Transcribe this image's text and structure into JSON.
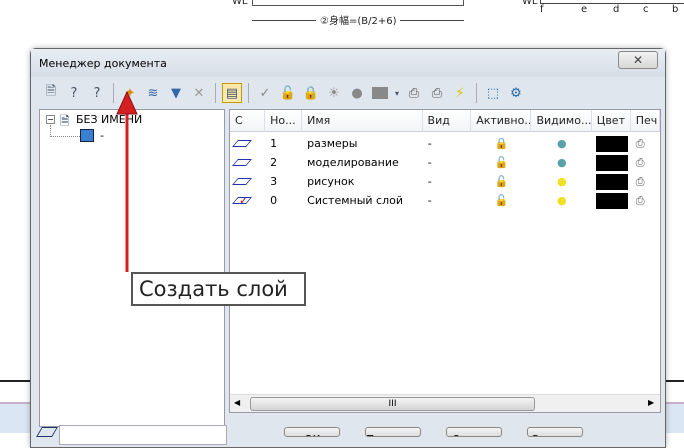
{
  "background": {
    "wl_left": "WL",
    "formula": "②身幅=(B/2+6)",
    "wl_right": "WL",
    "scale_letters": [
      "f",
      "e",
      "d",
      "c",
      "b"
    ]
  },
  "dialog": {
    "title": "Менеджер документа",
    "close_glyph": "✕",
    "toolbar": [
      "new-doc-icon",
      "layer-numbers-icon",
      "help-layers-icon",
      "create-layer-icon",
      "layer-stack-icon",
      "layer-filter-icon",
      "delete-icon",
      "panel-view-icon",
      "check-icon",
      "unlock-icon",
      "lock-icon",
      "light-on-icon",
      "light-off-icon",
      "color-icon",
      "print-icon",
      "no-print-icon",
      "layer-bolt-icon",
      "select-icon",
      "tools-icon"
    ],
    "tree": {
      "root": "БЕЗ ИМЕНИ",
      "child": "-"
    },
    "columns": [
      "С",
      "Но...",
      "Имя",
      "Вид",
      "Активно...",
      "Видимо...",
      "Цвет",
      "Печ"
    ],
    "rows": [
      {
        "num": "1",
        "name": "размеры",
        "view": "-",
        "lock": "locked",
        "light": "off"
      },
      {
        "num": "2",
        "name": "моделирование",
        "view": "-",
        "lock": "unlocked",
        "light": "off"
      },
      {
        "num": "3",
        "name": "рисунок",
        "view": "-",
        "lock": "unlocked",
        "light": "on"
      },
      {
        "num": "0",
        "name": "Системный слой",
        "view": "-",
        "lock": "unlocked",
        "light": "on"
      }
    ],
    "scroll_grip": "III",
    "buttons": [
      "OK",
      "Применить",
      "Отмена",
      "Справка"
    ]
  },
  "callout": {
    "text": "Создать слой",
    "arrow_color": "#d42020"
  }
}
